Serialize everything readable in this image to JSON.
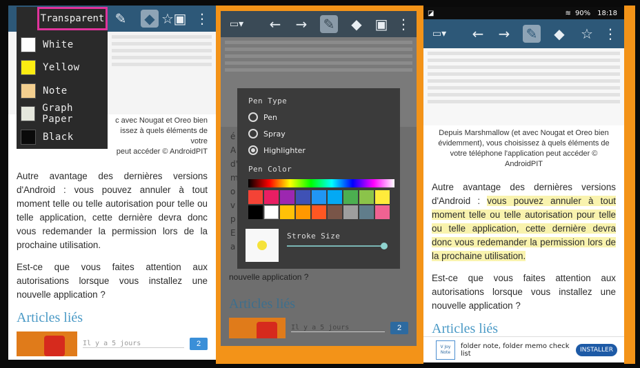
{
  "left_panel": {
    "menu": {
      "title": "Transparent",
      "items": [
        {
          "label": "White",
          "color": "#ffffff"
        },
        {
          "label": "Yellow",
          "color": "#fbec12"
        },
        {
          "label": "Note",
          "color": "#f3cf8f"
        },
        {
          "label": "Graph Paper",
          "color": "#e5e7dd"
        },
        {
          "label": "Black",
          "color": "#0a0a0a"
        }
      ]
    },
    "caption_lines": [
      "c avec Nougat et Oreo bien",
      "issez à quels éléments de votre",
      "peut accéder © AndroidPIT"
    ],
    "para1": "Autre avantage des dernières versions d'Android : vous pouvez annuler à tout moment telle ou telle autorisation pour telle ou telle application, cette dernière devra donc vous redemander la permission lors de la prochaine utilisation.",
    "para2": "Est-ce que vous faites attention aux autorisations lorsque vous installez une nouvelle application ?",
    "related": "Articles liés",
    "ago": "Il y a 5 jours",
    "bubble": "2"
  },
  "middle_panel": {
    "dialog": {
      "pen_type_label": "Pen Type",
      "options": [
        {
          "label": "Pen",
          "selected": false
        },
        {
          "label": "Spray",
          "selected": false
        },
        {
          "label": "Highlighter",
          "selected": true
        }
      ],
      "pen_color_label": "Pen Color",
      "stroke_label": "Stroke Size",
      "swatches_row1": [
        "#f44336",
        "#e91e63",
        "#9c27b0",
        "#3f51b5",
        "#2196f3",
        "#03a9f4",
        "#4caf50",
        "#8bc34a",
        "#ffeb3b"
      ],
      "swatches_row2": [
        "#000000",
        "#ffffff",
        "#ffc107",
        "#ff9800",
        "#ff5722",
        "#795548",
        "#9e9e9e",
        "#607d8b",
        "#f06292"
      ],
      "preview_dot_color": "#f5e23a"
    },
    "tail_text": "nouvelle application ?",
    "side_words": [
      "é",
      "A",
      "d'",
      "m",
      "o",
      "v",
      "p",
      "E",
      "a"
    ],
    "related": "Articles liés",
    "ago": "Il y a 5 jours",
    "bubble": "2"
  },
  "right_panel": {
    "status": {
      "battery": "90%",
      "time": "18:18"
    },
    "caption": "Depuis Marshmallow (et avec Nougat et Oreo bien évidemment), vous choisissez à quels éléments de votre téléphone l'application peut accéder © AndroidPIT",
    "para1_plain": "Autre avantage des dernières versions d'Android : ",
    "para1_highlight": "vous pouvez annuler à tout moment telle ou telle autorisation pour telle ou telle application, cette dernière devra donc vous redemander la permission lors de la prochaine utilisation.",
    "para2": "Est-ce que vous faites attention aux autorisations lorsque vous installez une nouvelle application ?",
    "related": "Articles liés",
    "ad": {
      "text": "folder note, folder memo check list",
      "button": "INSTALLER",
      "logo_line1": "V Joy",
      "logo_line2": "Note"
    }
  }
}
